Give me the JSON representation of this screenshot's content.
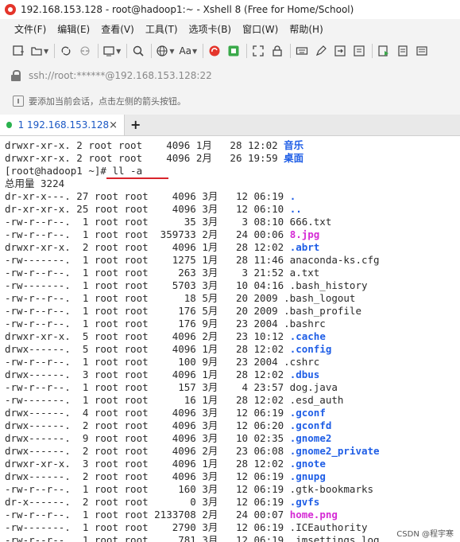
{
  "window": {
    "title": "192.168.153.128 - root@hadoop1:~ - Xshell 8 (Free for Home/School)"
  },
  "menu": {
    "items": [
      "文件(F)",
      "编辑(E)",
      "查看(V)",
      "工具(T)",
      "选项卡(B)",
      "窗口(W)",
      "帮助(H)"
    ]
  },
  "toolbar": {
    "font_label": "Aa"
  },
  "address": {
    "text": "ssh://root:******@192.168.153.128:22"
  },
  "hint": {
    "text": "要添加当前会话，点击左侧的箭头按钮。"
  },
  "tabs": [
    {
      "number": "1",
      "label": "1 192.168.153.128",
      "status_color": "#2ab24e"
    }
  ],
  "tab_add_symbol": "+",
  "tab_close_symbol": "×",
  "terminal": {
    "lines": [
      {
        "prefix": "drwxr-xr-x. 2 root root    4096 1月   28 12:02 ",
        "name": "音乐",
        "color": "blue"
      },
      {
        "prefix": "drwxr-xr-x. 2 root root    4096 2月   26 19:59 ",
        "name": "桌面",
        "color": "blue"
      },
      {
        "prefix": "[root@hadoop1 ~]# ll -a",
        "name": "",
        "color": ""
      },
      {
        "prefix": "总用量 3224",
        "name": "",
        "color": ""
      },
      {
        "prefix": "dr-xr-x---. 27 root root    4096 3月   12 06:19 ",
        "name": ".",
        "color": "blue"
      },
      {
        "prefix": "dr-xr-xr-x. 25 root root    4096 3月   12 06:10 ",
        "name": "..",
        "color": "blue"
      },
      {
        "prefix": "-rw-r--r--.  1 root root      35 3月    3 08:10 666.txt",
        "name": "",
        "color": ""
      },
      {
        "prefix": "-rw-r--r--.  1 root root  359733 2月   24 00:06 ",
        "name": "8.jpg",
        "color": "pink"
      },
      {
        "prefix": "drwxr-xr-x.  2 root root    4096 1月   28 12:02 ",
        "name": ".abrt",
        "color": "blue"
      },
      {
        "prefix": "-rw-------.  1 root root    1275 1月   28 11:46 anaconda-ks.cfg",
        "name": "",
        "color": ""
      },
      {
        "prefix": "-rw-r--r--.  1 root root     263 3月    3 21:52 a.txt",
        "name": "",
        "color": ""
      },
      {
        "prefix": "-rw-------.  1 root root    5703 3月   10 04:16 .bash_history",
        "name": "",
        "color": ""
      },
      {
        "prefix": "-rw-r--r--.  1 root root      18 5月   20 2009 .bash_logout",
        "name": "",
        "color": ""
      },
      {
        "prefix": "-rw-r--r--.  1 root root     176 5月   20 2009 .bash_profile",
        "name": "",
        "color": ""
      },
      {
        "prefix": "-rw-r--r--.  1 root root     176 9月   23 2004 .bashrc",
        "name": "",
        "color": ""
      },
      {
        "prefix": "drwxr-xr-x.  5 root root    4096 2月   23 10:12 ",
        "name": ".cache",
        "color": "blue"
      },
      {
        "prefix": "drwx------.  5 root root    4096 1月   28 12:02 ",
        "name": ".config",
        "color": "blue"
      },
      {
        "prefix": "-rw-r--r--.  1 root root     100 9月   23 2004 .cshrc",
        "name": "",
        "color": ""
      },
      {
        "prefix": "drwx------.  3 root root    4096 1月   28 12:02 ",
        "name": ".dbus",
        "color": "blue"
      },
      {
        "prefix": "-rw-r--r--.  1 root root     157 3月    4 23:57 dog.java",
        "name": "",
        "color": ""
      },
      {
        "prefix": "-rw-------.  1 root root      16 1月   28 12:02 .esd_auth",
        "name": "",
        "color": ""
      },
      {
        "prefix": "drwx------.  4 root root    4096 3月   12 06:19 ",
        "name": ".gconf",
        "color": "blue"
      },
      {
        "prefix": "drwx------.  2 root root    4096 3月   12 06:20 ",
        "name": ".gconfd",
        "color": "blue"
      },
      {
        "prefix": "drwx------.  9 root root    4096 3月   10 02:35 ",
        "name": ".gnome2",
        "color": "blue"
      },
      {
        "prefix": "drwx------.  2 root root    4096 2月   23 06:08 ",
        "name": ".gnome2_private",
        "color": "blue"
      },
      {
        "prefix": "drwxr-xr-x.  3 root root    4096 1月   28 12:02 ",
        "name": ".gnote",
        "color": "blue"
      },
      {
        "prefix": "drwx------.  2 root root    4096 3月   12 06:19 ",
        "name": ".gnupg",
        "color": "blue"
      },
      {
        "prefix": "-rw-r--r--.  1 root root     160 3月   12 06:19 .gtk-bookmarks",
        "name": "",
        "color": ""
      },
      {
        "prefix": "dr-x------.  2 root root       0 3月   12 06:19 ",
        "name": ".gvfs",
        "color": "blue"
      },
      {
        "prefix": "-rw-r--r--.  1 root root 2133708 2月   24 00:07 ",
        "name": "home.png",
        "color": "pink"
      },
      {
        "prefix": "-rw-------.  1 root root    2790 3月   12 06:19 .ICEauthority",
        "name": "",
        "color": ""
      },
      {
        "prefix": "-rw-r--r--.  1 root root     781 3月   12 06:19 .imsettings.log",
        "name": "",
        "color": ""
      }
    ]
  },
  "colors": {
    "blue": "#1f5ee6",
    "pink": "#d52bd5",
    "annotation": "#d8242c"
  },
  "watermark": "CSDN @程宇寒"
}
